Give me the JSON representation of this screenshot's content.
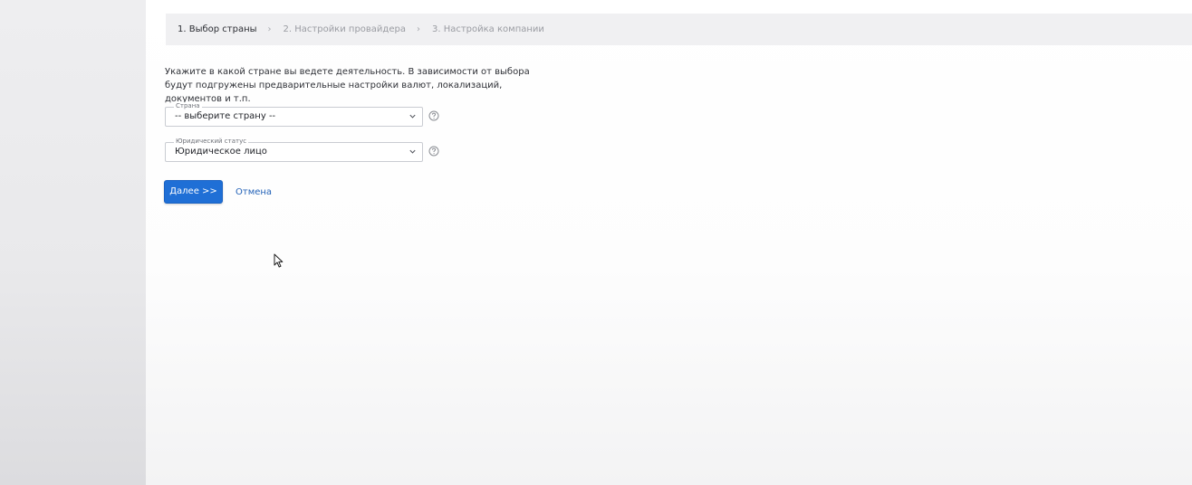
{
  "wizard": {
    "steps": [
      {
        "label": "1. Выбор страны"
      },
      {
        "label": "2. Настройки провайдера"
      },
      {
        "label": "3. Настройка компании"
      }
    ],
    "separator": "›"
  },
  "intro": {
    "text": "Укажите в какой стране вы ведете деятельность. В зависимости от выбора будут подгружены предварительные настройки валют, локализаций, документов и т.п."
  },
  "form": {
    "country": {
      "label": "Страна",
      "value": "-- выберите страну --"
    },
    "legal_status": {
      "label": "Юридический статус",
      "value": "Юридическое лицо"
    }
  },
  "actions": {
    "next_label": "Далее >>",
    "cancel_label": "Отмена"
  },
  "colors": {
    "primary": "#1f6fd6",
    "link": "#2463b8",
    "stepper_bg": "#f0f0f2"
  }
}
